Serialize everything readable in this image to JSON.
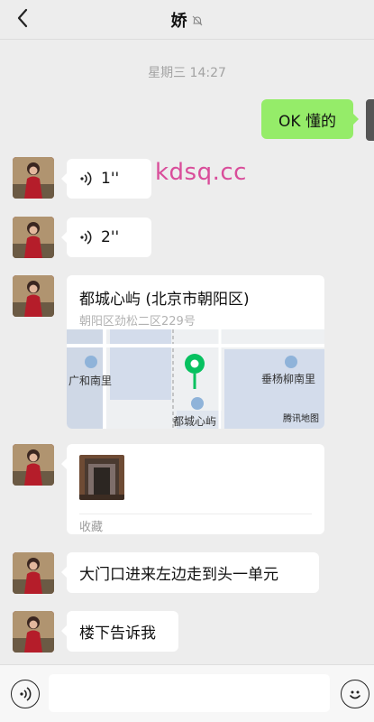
{
  "header": {
    "title": "娇",
    "back_icon": "chevron-left-icon",
    "mute_icon": "bell-off-icon"
  },
  "timestamp": "星期三 14:27",
  "watermark": "kdsq.cc",
  "messages": {
    "sent_text": "OK 懂的",
    "voice1_duration": "1''",
    "voice2_duration": "2''",
    "location": {
      "title": "都城心屿 (北京市朝阳区)",
      "address": "朝阳区劲松二区229号",
      "map_labels": {
        "left_place": "广和南里",
        "right_place": "垂杨柳南里",
        "center_place": "都城心屿",
        "provider": "腾讯地图"
      }
    },
    "favorite_label": "收藏",
    "text1": "大门口进来左边走到头一单元",
    "text2": "楼下告诉我"
  },
  "bottom_bar": {
    "voice_icon": "voice-icon",
    "emoji_icon": "emoji-icon",
    "input_value": ""
  },
  "colors": {
    "sent_bubble": "#95ec69",
    "received_bubble": "#ffffff",
    "background": "#ededed",
    "pin": "#07c160"
  }
}
